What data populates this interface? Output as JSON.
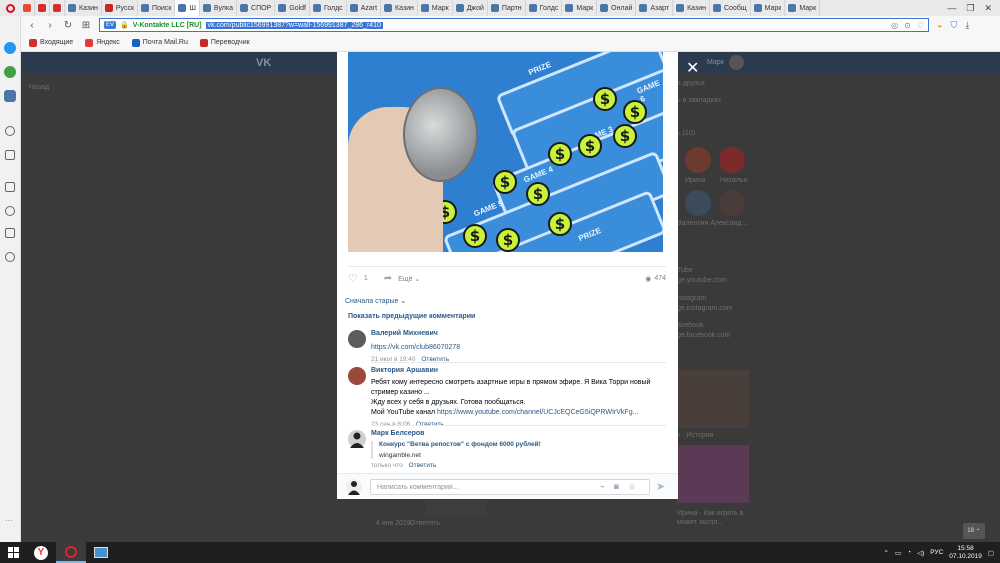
{
  "browser": {
    "tabs": [
      {
        "label": "",
        "color": "#e84a2f"
      },
      {
        "label": "",
        "color": "#d32f2f"
      },
      {
        "label": "",
        "color": "#d32f2f"
      },
      {
        "label": "Казин",
        "color": "#4a76a8"
      },
      {
        "label": "Русск",
        "color": "#c62828"
      },
      {
        "label": "Поиск",
        "color": "#4a76a8"
      },
      {
        "label": "Ш",
        "color": "#4a76a8",
        "active": true
      },
      {
        "label": "Вулка",
        "color": "#4a76a8"
      },
      {
        "label": "СПОР",
        "color": "#4a76a8"
      },
      {
        "label": "Goldf",
        "color": "#4a76a8"
      },
      {
        "label": "Голдс",
        "color": "#4a76a8"
      },
      {
        "label": "Azart",
        "color": "#4a76a8"
      },
      {
        "label": "Казин",
        "color": "#4a76a8"
      },
      {
        "label": "Марк",
        "color": "#4a76a8"
      },
      {
        "label": "Джой",
        "color": "#4a76a8"
      },
      {
        "label": "Партн",
        "color": "#4a76a8"
      },
      {
        "label": "Голдс",
        "color": "#4a76a8"
      },
      {
        "label": "Марк",
        "color": "#4a76a8"
      },
      {
        "label": "Онлай",
        "color": "#4a76a8"
      },
      {
        "label": "Азарт",
        "color": "#4a76a8"
      },
      {
        "label": "Казин",
        "color": "#4a76a8"
      },
      {
        "label": "Сообщ",
        "color": "#4a76a8"
      },
      {
        "label": "Марк",
        "color": "#4a76a8"
      },
      {
        "label": "Марк",
        "color": "#4a76a8"
      }
    ],
    "address": {
      "ssl_badge": "EV",
      "cert_owner": "V-Kontakte LLC [RU]",
      "url": "vk.com/public156991387?w=wall-156991387_286_r410"
    },
    "bookmarks": [
      {
        "label": "Входящие",
        "color": "#d32f2f"
      },
      {
        "label": "Яндекс",
        "color": "#e53935"
      },
      {
        "label": "Почта Mail.Ru",
        "color": "#1565c0"
      },
      {
        "label": "Переводчик",
        "color": "#c62828"
      }
    ]
  },
  "post": {
    "image": {
      "description": "scratch card",
      "game_labels": [
        "GAME 3",
        "GAME 4",
        "GAME 5",
        "GAME 6",
        "PRIZE",
        "PRIZE"
      ],
      "symbol": "$"
    },
    "likes": "1",
    "share_label": "Ещё",
    "views": "474"
  },
  "comments": {
    "sort_label": "Сначала старые",
    "show_previous": "Показать предыдущие комментарии",
    "items": [
      {
        "author": "Валерий Михневич",
        "link": "https://vk.com/club86070278",
        "date": "21 июл в 19:40",
        "reply": "Ответить",
        "avatar_color": "#5c5c5c"
      },
      {
        "author": "Виктория Аршавин",
        "text_line1": "Ребят кому интересно смотреть азартные игры в прямом эфире. Я Вика Торри новый",
        "text_line2": "стример казино ...",
        "text_line3": "Жду всех у себя в друзьях. Готова пообщаться.",
        "text_line4_prefix": "Мой YouTube канал",
        "text_line4_link": "https://www.youtube.com/channel/UCJcEQCeG5iQPRWIrVkFg...",
        "date": "23 сен в 6:06",
        "reply": "Ответить",
        "avatar_color": "#9b4a3a"
      },
      {
        "author": "Марк Белсеров",
        "snippet_title": "Конкурс \"Ветва репостов\" с фондом 6000 рублей!",
        "snippet_site": "wingamble.net",
        "date": "только что",
        "reply": "Ответить",
        "avatar_color": "#cfcfcf"
      }
    ]
  },
  "comment_form": {
    "placeholder": "Написать комментарий..."
  },
  "background_page": {
    "header_logo": "VK",
    "user_name": "Марк",
    "back_link": "Назад",
    "side_texts": [
      "в друзья",
      "ь в закладках",
      "ь (10)",
      "Ирина",
      "Наталья",
      "Валентин Александ...",
      "Tube",
      "ge.youtube.com",
      "nstagram",
      "ge.instagram.com",
      "acebook",
      "ge.facebook.com",
      "к · История",
      "Ирина · Как играть в",
      "может экспл..."
    ],
    "bottom_texts": [
      "4 янв 2019",
      "Ответить"
    ]
  },
  "taskbar": {
    "language": "РУС",
    "time": "15:58",
    "date": "07.10.2019",
    "scroll_up_label": "18"
  }
}
